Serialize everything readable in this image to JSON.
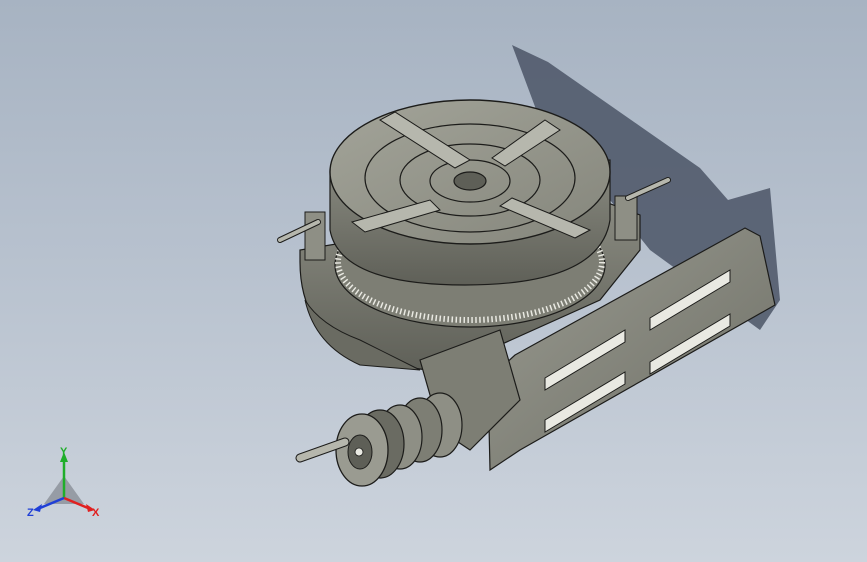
{
  "viewport": {
    "background_top": "#a7b3c2",
    "background_bottom": "#cdd4dd"
  },
  "model": {
    "colors": {
      "body": "#8e8f85",
      "body_dark": "#5e5f57",
      "body_light": "#b6b7ad",
      "edge": "#1c1c1a",
      "shadow": "#4b5566",
      "highlight": "#e9e9e2"
    }
  },
  "triad": {
    "x_label": "X",
    "y_label": "Y",
    "z_label": "Z",
    "x_color": "#e02020",
    "y_color": "#1fae2a",
    "z_color": "#1f3fd6"
  }
}
